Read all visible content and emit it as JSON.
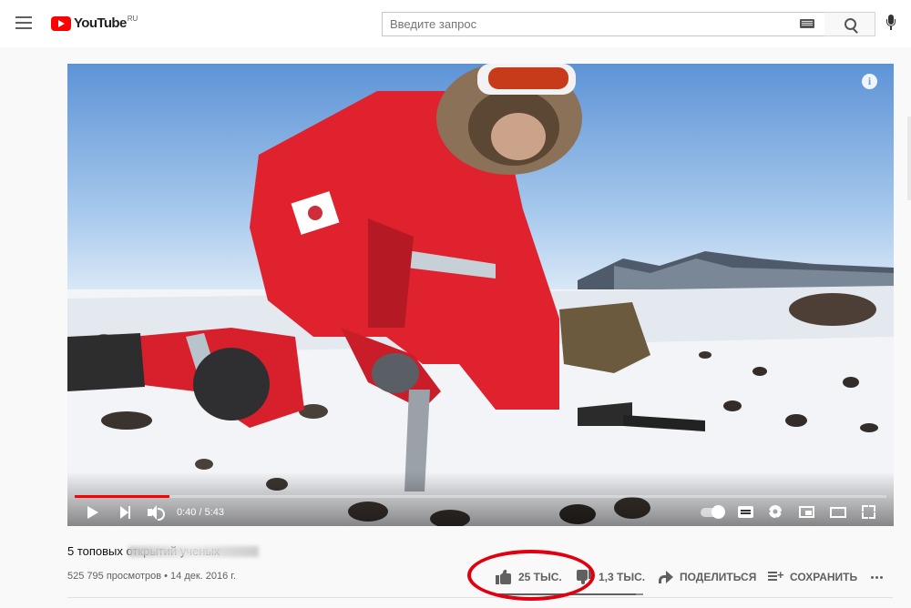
{
  "header": {
    "logo_text": "YouTube",
    "logo_region": "RU",
    "search_placeholder": "Введите запрос"
  },
  "player": {
    "current_time": "0:40",
    "duration": "5:43",
    "time_display": "0:40 / 5:43",
    "progress_fraction": 0.1166,
    "info_glyph": "i",
    "controls": [
      "play-icon",
      "next-icon",
      "volume-icon",
      "autoplay-toggle",
      "subtitles-icon",
      "gear-icon",
      "miniplayer-icon",
      "theater-icon",
      "fullscreen-icon"
    ]
  },
  "video": {
    "title": "5 топовых открытий ученых",
    "meta": "525 795 просмотров • 14 дек. 2016 г."
  },
  "actions": {
    "like_count": "25 ТЫС.",
    "dislike_count": "1,3 ТЫС.",
    "share_label": "ПОДЕЛИТЬСЯ",
    "save_label": "СОХРАНИТЬ",
    "like_ratio": 0.95
  },
  "colors": {
    "brand_red": "#ff0000",
    "annotation_red": "#e10010",
    "secondary_text": "#606060"
  }
}
